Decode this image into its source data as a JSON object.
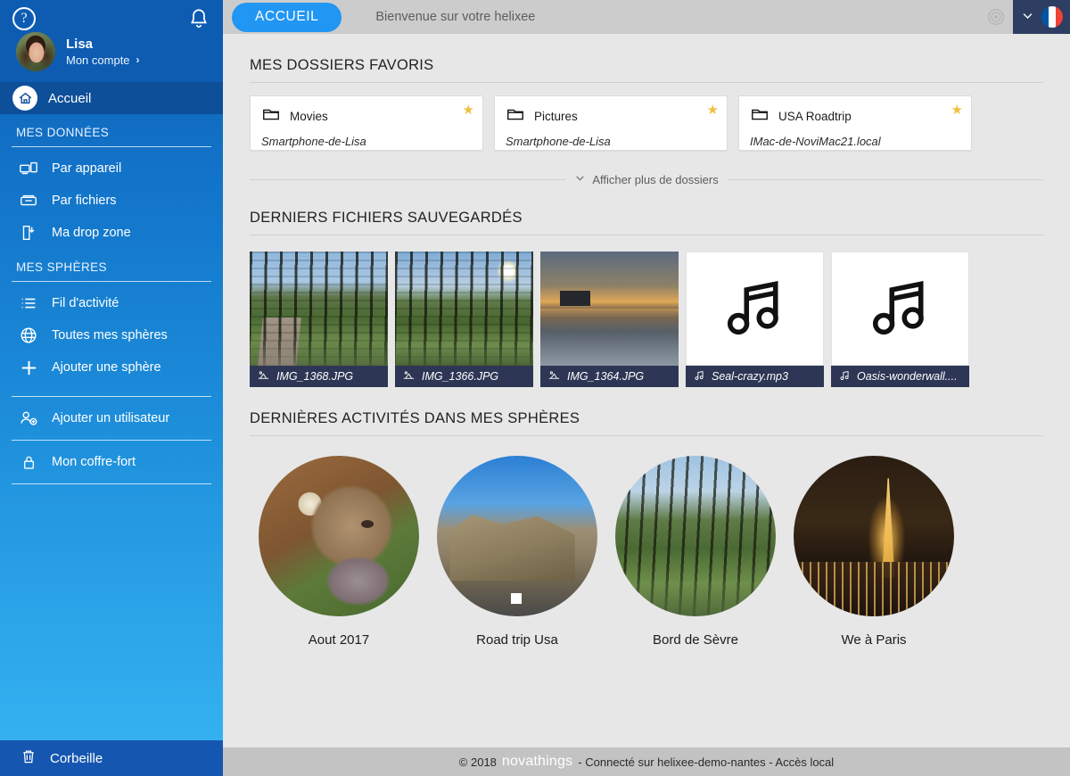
{
  "sidebar": {
    "help_icon": "help-circle-icon",
    "bell_icon": "bell-icon",
    "user": {
      "name": "Lisa",
      "account_label": "Mon compte",
      "chevron": "›"
    },
    "active_item": {
      "label": "Accueil",
      "icon": "home-icon"
    },
    "sections": [
      {
        "title": "MES DONNÉES",
        "items": [
          {
            "label": "Par appareil",
            "icon": "devices-icon"
          },
          {
            "label": "Par fichiers",
            "icon": "files-icon"
          },
          {
            "label": "Ma drop zone",
            "icon": "dropzone-icon"
          }
        ]
      },
      {
        "title": "MES SPHÈRES",
        "items": [
          {
            "label": "Fil d'activité",
            "icon": "list-icon"
          },
          {
            "label": "Toutes mes sphères",
            "icon": "sphere-icon"
          },
          {
            "label": "Ajouter une sphère",
            "icon": "plus-icon"
          }
        ]
      }
    ],
    "extra_items": [
      {
        "label": "Ajouter un utilisateur",
        "icon": "add-user-icon"
      },
      {
        "label": "Mon coffre-fort",
        "icon": "lock-icon"
      }
    ],
    "trash": {
      "label": "Corbeille",
      "icon": "trash-icon"
    }
  },
  "topbar": {
    "tab_label": "ACCUEIL",
    "welcome": "Bienvenue sur votre helixee",
    "target_icon": "target-icon",
    "chevron_icon": "chevron-down-icon",
    "flag_icon": "flag-france-icon"
  },
  "favorites": {
    "title": "MES DOSSIERS FAVORIS",
    "cards": [
      {
        "name": "Movies",
        "source": "Smartphone-de-Lisa",
        "icon": "folder-icon",
        "starred": "★"
      },
      {
        "name": "Pictures",
        "source": "Smartphone-de-Lisa",
        "icon": "folder-icon",
        "starred": "★"
      },
      {
        "name": "USA Roadtrip",
        "source": "IMac-de-NoviMac21.local",
        "icon": "folder-icon",
        "starred": "★"
      }
    ],
    "show_more": "Afficher plus de dossiers"
  },
  "recent_files": {
    "title": "DERNIERS FICHIERS SAUVEGARDÉS",
    "files": [
      {
        "name": "IMG_1368.JPG",
        "type": "image",
        "icon": "photo-icon"
      },
      {
        "name": "IMG_1366.JPG",
        "type": "image",
        "icon": "photo-icon"
      },
      {
        "name": "IMG_1364.JPG",
        "type": "image",
        "icon": "photo-icon"
      },
      {
        "name": "Seal-crazy.mp3",
        "type": "audio",
        "icon": "music-note-icon"
      },
      {
        "name": "Oasis-wonderwall....",
        "type": "audio",
        "icon": "music-note-icon"
      }
    ]
  },
  "spheres": {
    "title": "DERNIÈRES ACTIVITÉS DANS MES SPHÈRES",
    "items": [
      {
        "name": "Aout 2017"
      },
      {
        "name": "Road trip Usa"
      },
      {
        "name": "Bord de Sèvre"
      },
      {
        "name": "We à Paris"
      }
    ]
  },
  "footer": {
    "copyright": "© 2018",
    "brand": "novathings",
    "status": "- Connecté sur helixee-demo-nantes - Accès local"
  },
  "colors": {
    "sidebar_top": "#0d5cb2",
    "accent": "#2196f3",
    "label_bar": "#2e3655",
    "star": "#f0c040",
    "lang_box": "#2e3e63"
  }
}
